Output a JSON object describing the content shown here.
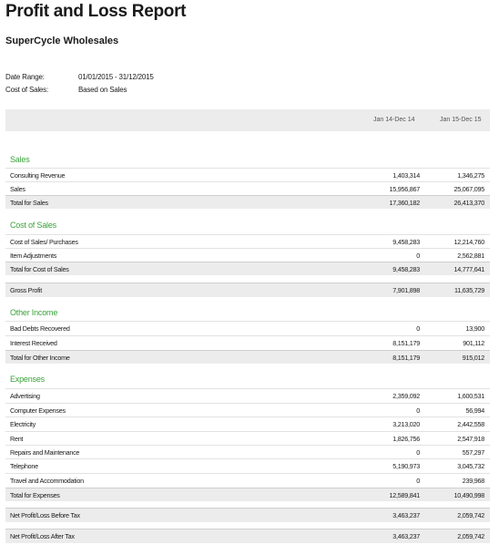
{
  "report": {
    "title": "Profit and Loss Report",
    "company": "SuperCycle Wholesales",
    "meta": {
      "date_range_label": "Date Range:",
      "date_range_value": "01/01/2015 - 31/12/2015",
      "cost_of_sales_label": "Cost of Sales:",
      "cost_of_sales_value": "Based on Sales"
    },
    "columns": [
      "Jan 14-Dec 14",
      "Jan 15-Dec 15"
    ],
    "sections": {
      "sales": "Sales",
      "cost_of_sales": "Cost of Sales",
      "other_income": "Other Income",
      "expenses": "Expenses"
    },
    "rows": {
      "consulting_revenue": {
        "label": "Consulting Revenue",
        "v1": "1,403,314",
        "v2": "1,346,275"
      },
      "sales": {
        "label": "Sales",
        "v1": "15,956,867",
        "v2": "25,067,095"
      },
      "total_sales": {
        "label": "Total for Sales",
        "v1": "17,360,182",
        "v2": "26,413,370"
      },
      "cost_purchases": {
        "label": "Cost of Sales/ Purchases",
        "v1": "9,458,283",
        "v2": "12,214,760"
      },
      "item_adjustments": {
        "label": "Item Adjustments",
        "v1": "0",
        "v2": "2,562,881"
      },
      "total_cost_of_sales": {
        "label": "Total for Cost of Sales",
        "v1": "9,458,283",
        "v2": "14,777,641"
      },
      "gross_profit": {
        "label": "Gross Profit",
        "v1": "7,901,898",
        "v2": "11,635,729"
      },
      "bad_debts": {
        "label": "Bad Debts Recovered",
        "v1": "0",
        "v2": "13,900"
      },
      "interest_received": {
        "label": "Interest Received",
        "v1": "8,151,179",
        "v2": "901,112"
      },
      "total_other_income": {
        "label": "Total for Other Income",
        "v1": "8,151,179",
        "v2": "915,012"
      },
      "advertising": {
        "label": "Advertising",
        "v1": "2,359,092",
        "v2": "1,600,531"
      },
      "computer_expenses": {
        "label": "Computer Expenses",
        "v1": "0",
        "v2": "56,994"
      },
      "electricity": {
        "label": "Electricity",
        "v1": "3,213,020",
        "v2": "2,442,558"
      },
      "rent": {
        "label": "Rent",
        "v1": "1,826,756",
        "v2": "2,547,918"
      },
      "repairs": {
        "label": "Repairs and Maintenance",
        "v1": "0",
        "v2": "557,297"
      },
      "telephone": {
        "label": "Telephone",
        "v1": "5,190,973",
        "v2": "3,045,732"
      },
      "travel": {
        "label": "Travel and Accommodation",
        "v1": "0",
        "v2": "239,968"
      },
      "total_expenses": {
        "label": "Total for Expenses",
        "v1": "12,589,841",
        "v2": "10,490,998"
      },
      "net_before_tax": {
        "label": "Net Profit/Loss Before Tax",
        "v1": "3,463,237",
        "v2": "2,059,742"
      },
      "net_after_tax": {
        "label": "Net Profit/Loss After Tax",
        "v1": "3,463,237",
        "v2": "2,059,742"
      }
    }
  }
}
